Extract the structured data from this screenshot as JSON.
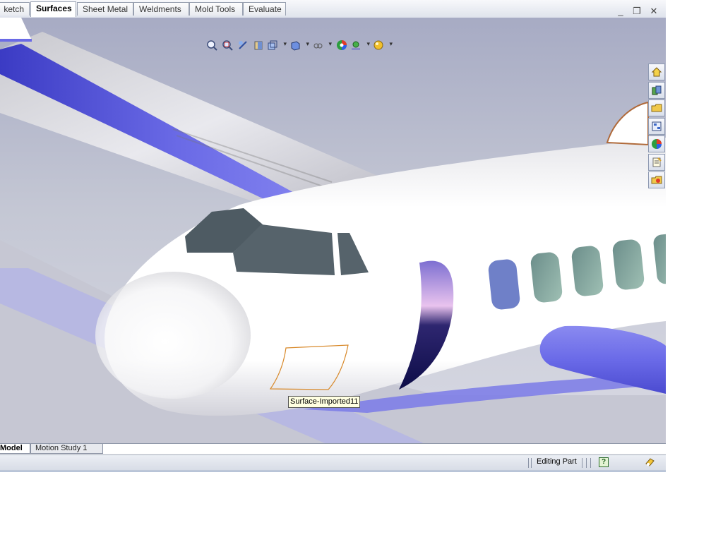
{
  "tabs": [
    {
      "label": "Sketch",
      "shown": "ketch",
      "active": false
    },
    {
      "label": "Surfaces",
      "active": true
    },
    {
      "label": "Sheet Metal",
      "active": false
    },
    {
      "label": "Weldments",
      "active": false
    },
    {
      "label": "Mold Tools",
      "active": false
    },
    {
      "label": "Evaluate",
      "active": false
    }
  ],
  "window_controls": {
    "minimize": "_",
    "restore": "❐",
    "close": "✕"
  },
  "view_toolbar": [
    "zoom-to-fit-icon",
    "zoom-to-area-icon",
    "previous-view-icon",
    "section-view-icon",
    "view-orientation-icon",
    "display-style-icon",
    "hide-show-items-icon",
    "edit-appearance-icon",
    "apply-scene-icon",
    "view-settings-icon"
  ],
  "task_pane": [
    "solidworks-resources-icon",
    "design-library-icon",
    "file-explorer-icon",
    "view-palette-icon",
    "appearances-scenes-icon",
    "custom-properties-icon",
    "solidworks-forum-icon"
  ],
  "tooltip": "Surface-Imported11",
  "bottom_tabs": [
    {
      "label": "Model",
      "active": true
    },
    {
      "label": "Motion Study 1",
      "active": false
    }
  ],
  "status": {
    "text": "Editing Part",
    "help": "?"
  },
  "colors": {
    "accent_blue": "#6a6ae6",
    "selection_orange": "#d8892a"
  }
}
